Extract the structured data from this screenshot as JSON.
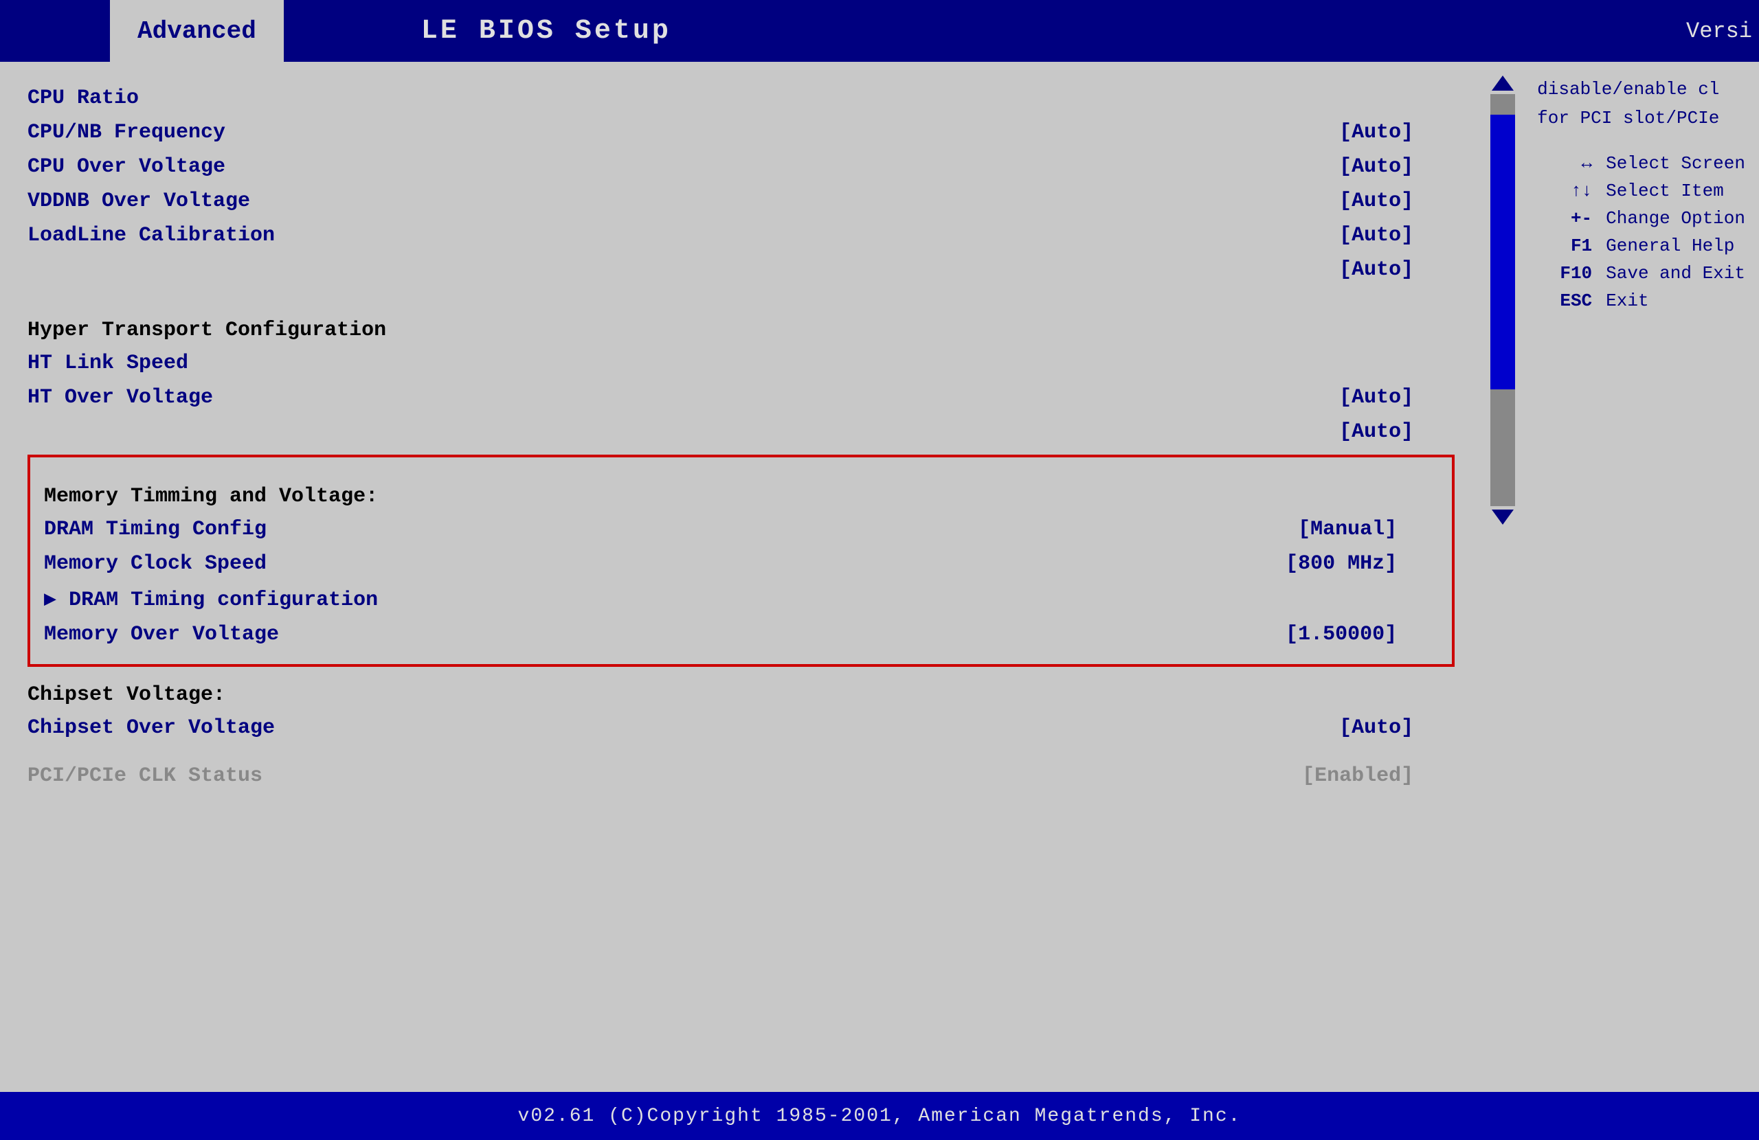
{
  "header": {
    "tab_label": "Advanced",
    "title": "LE BIOS  Setup",
    "version_label": "Versi"
  },
  "menu": {
    "items": [
      {
        "label": "CPU Ratio",
        "value": ""
      },
      {
        "label": "CPU/NB Frequency",
        "value": "[Auto]"
      },
      {
        "label": "CPU Over Voltage",
        "value": "[Auto]"
      },
      {
        "label": "VDDNB Over Voltage",
        "value": "[Auto]"
      },
      {
        "label": "LoadLine Calibration",
        "value": "[Auto]"
      },
      {
        "label": "",
        "value": "[Auto]"
      }
    ],
    "ht_section_header": "Hyper Transport Configuration",
    "ht_items": [
      {
        "label": "HT Link Speed",
        "value": ""
      },
      {
        "label": "HT Over Voltage",
        "value": "[Auto]"
      },
      {
        "label": "",
        "value": "[Auto]"
      }
    ],
    "memory_section_header": "Memory Timming and Voltage:",
    "memory_items": [
      {
        "label": "DRAM Timing Config",
        "value": "[Manual]"
      },
      {
        "label": "Memory Clock Speed",
        "value": "[800 MHz]"
      },
      {
        "label": "▶  DRAM Timing configuration",
        "value": ""
      },
      {
        "label": "Memory Over Voltage",
        "value": "[1.50000]"
      }
    ],
    "chipset_section_header": "Chipset Voltage:",
    "chipset_items": [
      {
        "label": "Chipset Over Voltage",
        "value": "[Auto]"
      }
    ],
    "pci_items": [
      {
        "label": "PCI/PCIe CLK Status",
        "value": "[Enabled]"
      }
    ]
  },
  "help": {
    "description_line1": "disable/enable cl",
    "description_line2": "for PCI slot/PCIe",
    "keys": [
      {
        "key": "↔",
        "desc": "Select Screen"
      },
      {
        "key": "↑↓",
        "desc": "Select Item"
      },
      {
        "key": "+-",
        "desc": "Change Option"
      },
      {
        "key": "F1",
        "desc": "General Help"
      },
      {
        "key": "F10",
        "desc": "Save and Exit"
      },
      {
        "key": "ESC",
        "desc": "Exit"
      }
    ]
  },
  "footer": {
    "text": "v02.61  (C)Copyright 1985-2001, American Megatrends, Inc."
  }
}
